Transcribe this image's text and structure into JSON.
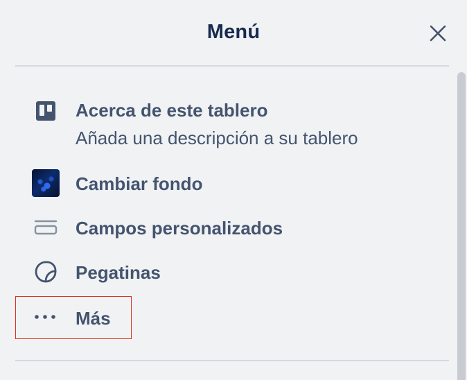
{
  "header": {
    "title": "Menú",
    "close_icon": "close-icon"
  },
  "menu": {
    "items": [
      {
        "id": "about",
        "icon": "board-icon",
        "label": "Acerca de este tablero",
        "sublabel": "Añada una descripción a su tablero"
      },
      {
        "id": "background",
        "icon": "background-thumbnail",
        "label": "Cambiar fondo"
      },
      {
        "id": "custom-fields",
        "icon": "custom-fields-icon",
        "label": "Campos personalizados"
      },
      {
        "id": "stickers",
        "icon": "sticker-icon",
        "label": "Pegatinas"
      },
      {
        "id": "more",
        "icon": "more-icon",
        "label": "Más",
        "highlighted": true
      }
    ]
  },
  "colors": {
    "background": "#f1f2f4",
    "title": "#172b4d",
    "text": "#44546f",
    "divider": "#d5d8dd",
    "highlight_border": "#e0301e"
  }
}
